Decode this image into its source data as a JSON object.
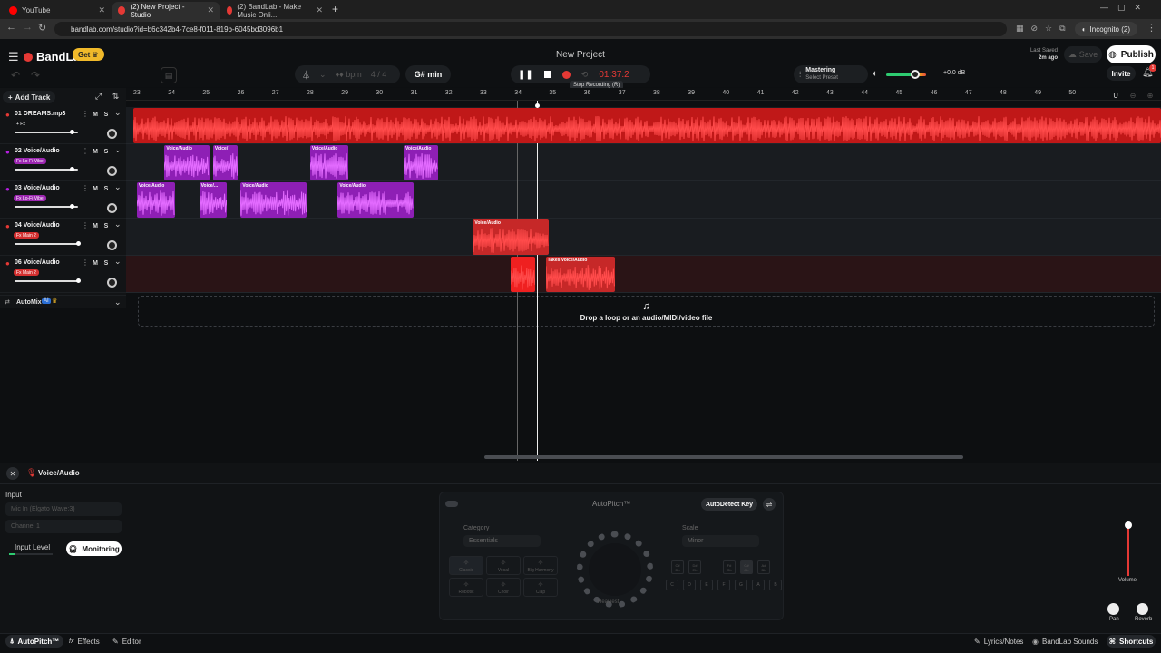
{
  "browser": {
    "tabs": [
      {
        "label": "YouTube",
        "fav_color": "#ff0000"
      },
      {
        "label": "(2) New Project - Studio",
        "fav_color": "#e53935"
      },
      {
        "label": "(2) BandLab - Make Music Onli...",
        "fav_color": "#e53935"
      }
    ],
    "url": "bandlab.com/studio?id=b6c342b4-7ce8-f011-819b-6045bd3096b1",
    "incognito": "Incognito (2)"
  },
  "header": {
    "brand": "BandLab",
    "get_label": "Get",
    "project_title": "New Project",
    "last_saved_label": "Last Saved",
    "last_saved_value": "2m ago",
    "save_label": "Save",
    "publish_label": "Publish",
    "invite_label": "Invite",
    "notif_count": "1"
  },
  "transport": {
    "bpm_label": "bpm",
    "time_sig": "4 / 4",
    "key": "G# min",
    "time": "01:37.2",
    "tooltip": "Stop Recording (R)",
    "mastering_label": "Mastering",
    "mastering_preset": "Select Preset",
    "volume_db": "+0.0 dB"
  },
  "tracks_panel": {
    "add_track": "Add Track",
    "automix_label": "AutoMix",
    "automix_badge": "AI"
  },
  "tracks": [
    {
      "name": "01  DREAMS.mp3",
      "badge": "+ Fx",
      "badge_color": "transparent",
      "color": "#e53935",
      "volume": 0.9,
      "pan": 0.5
    },
    {
      "name": "02  Voice/Audio",
      "badge": "Fx Lo-Fi Vibe",
      "badge_color": "#9c27b0",
      "color": "#b61ee0",
      "volume": 0.9,
      "pan": 0.5
    },
    {
      "name": "03  Voice/Audio",
      "badge": "Fx Lo-Fi Vibe",
      "badge_color": "#9c27b0",
      "color": "#b61ee0",
      "volume": 0.9,
      "pan": 0.5
    },
    {
      "name": "04  Voice/Audio",
      "badge": "Fx Main 2",
      "badge_color": "#d32f2f",
      "color": "#e53935",
      "volume": 1.0,
      "pan": 0.5
    },
    {
      "name": "06  Voice/Audio",
      "badge": "Fx Main 2",
      "badge_color": "#d32f2f",
      "color": "#e53935",
      "volume": 1.0,
      "pan": 0.5
    }
  ],
  "ruler": [
    "23",
    "24",
    "25",
    "26",
    "27",
    "28",
    "29",
    "30",
    "31",
    "32",
    "33",
    "34",
    "35",
    "36",
    "37",
    "38",
    "39",
    "40",
    "41",
    "42",
    "43",
    "44",
    "45",
    "46",
    "47",
    "48",
    "49",
    "50"
  ],
  "clips": [
    {
      "label": "",
      "track": 0,
      "start": 23.0,
      "end": 53.0,
      "color": "#c01818"
    },
    {
      "label": "Voice/Audio",
      "track": 1,
      "start": 23.9,
      "end": 25.2,
      "color": "#8e1fb5"
    },
    {
      "label": "Voice/",
      "track": 1,
      "start": 25.3,
      "end": 26.0,
      "color": "#8e1fb5"
    },
    {
      "label": "Voice/Audio",
      "track": 1,
      "start": 28.1,
      "end": 29.2,
      "color": "#8e1fb5"
    },
    {
      "label": "Voice/Audio",
      "track": 1,
      "start": 30.8,
      "end": 31.8,
      "color": "#8e1fb5"
    },
    {
      "label": "Voice/Audio",
      "track": 2,
      "start": 23.1,
      "end": 24.2,
      "color": "#8e1fb5"
    },
    {
      "label": "Voice/...",
      "track": 2,
      "start": 24.9,
      "end": 25.7,
      "color": "#8e1fb5"
    },
    {
      "label": "Voice/Audio",
      "track": 2,
      "start": 26.1,
      "end": 28.0,
      "color": "#8e1fb5"
    },
    {
      "label": "Voice/Audio",
      "track": 2,
      "start": 28.9,
      "end": 31.1,
      "color": "#8e1fb5"
    },
    {
      "label": "Voice/Audio",
      "track": 3,
      "start": 32.8,
      "end": 35.0,
      "color": "#c62828"
    },
    {
      "label": "",
      "track": 4,
      "start": 33.9,
      "end": 34.6,
      "color": "#ef2020"
    },
    {
      "label": "Takes  Voice/Audio",
      "track": 4,
      "start": 34.9,
      "end": 36.9,
      "color": "#c62828"
    }
  ],
  "drop_hint": "Drop a loop or an audio/MIDI/video file",
  "bottom": {
    "track_name": "Voice/Audio",
    "input_label": "Input",
    "input_device": "Mic In (Elgato Wave:3)",
    "channel": "Channel 1",
    "input_level_label": "Input Level",
    "monitoring_label": "Monitoring",
    "autopitch_title": "AutoPitch™",
    "autodetect_label": "AutoDetect Key",
    "category_label": "Category",
    "category_value": "Essentials",
    "scale_label": "Scale",
    "scale_value": "Minor",
    "presets": [
      "Classic",
      "Vocal",
      "Big Harmony",
      "Robotic",
      "Choir",
      "Clap"
    ],
    "knob_label": "Heaviest",
    "keys_top": [
      "C#\nDb",
      "D#\nEb",
      "F#\nGb",
      "G#\nAb",
      "A#\nBb"
    ],
    "keys_bottom": [
      "C",
      "D",
      "E",
      "F",
      "G",
      "A",
      "B"
    ],
    "volume_label": "Volume",
    "pan_label": "Pan",
    "reverb_label": "Reverb"
  },
  "footer": {
    "autopitch": "AutoPitch™",
    "effects": "Effects",
    "editor": "Editor",
    "lyrics": "Lyrics/Notes",
    "sounds": "BandLab Sounds",
    "shortcuts": "Shortcuts"
  }
}
